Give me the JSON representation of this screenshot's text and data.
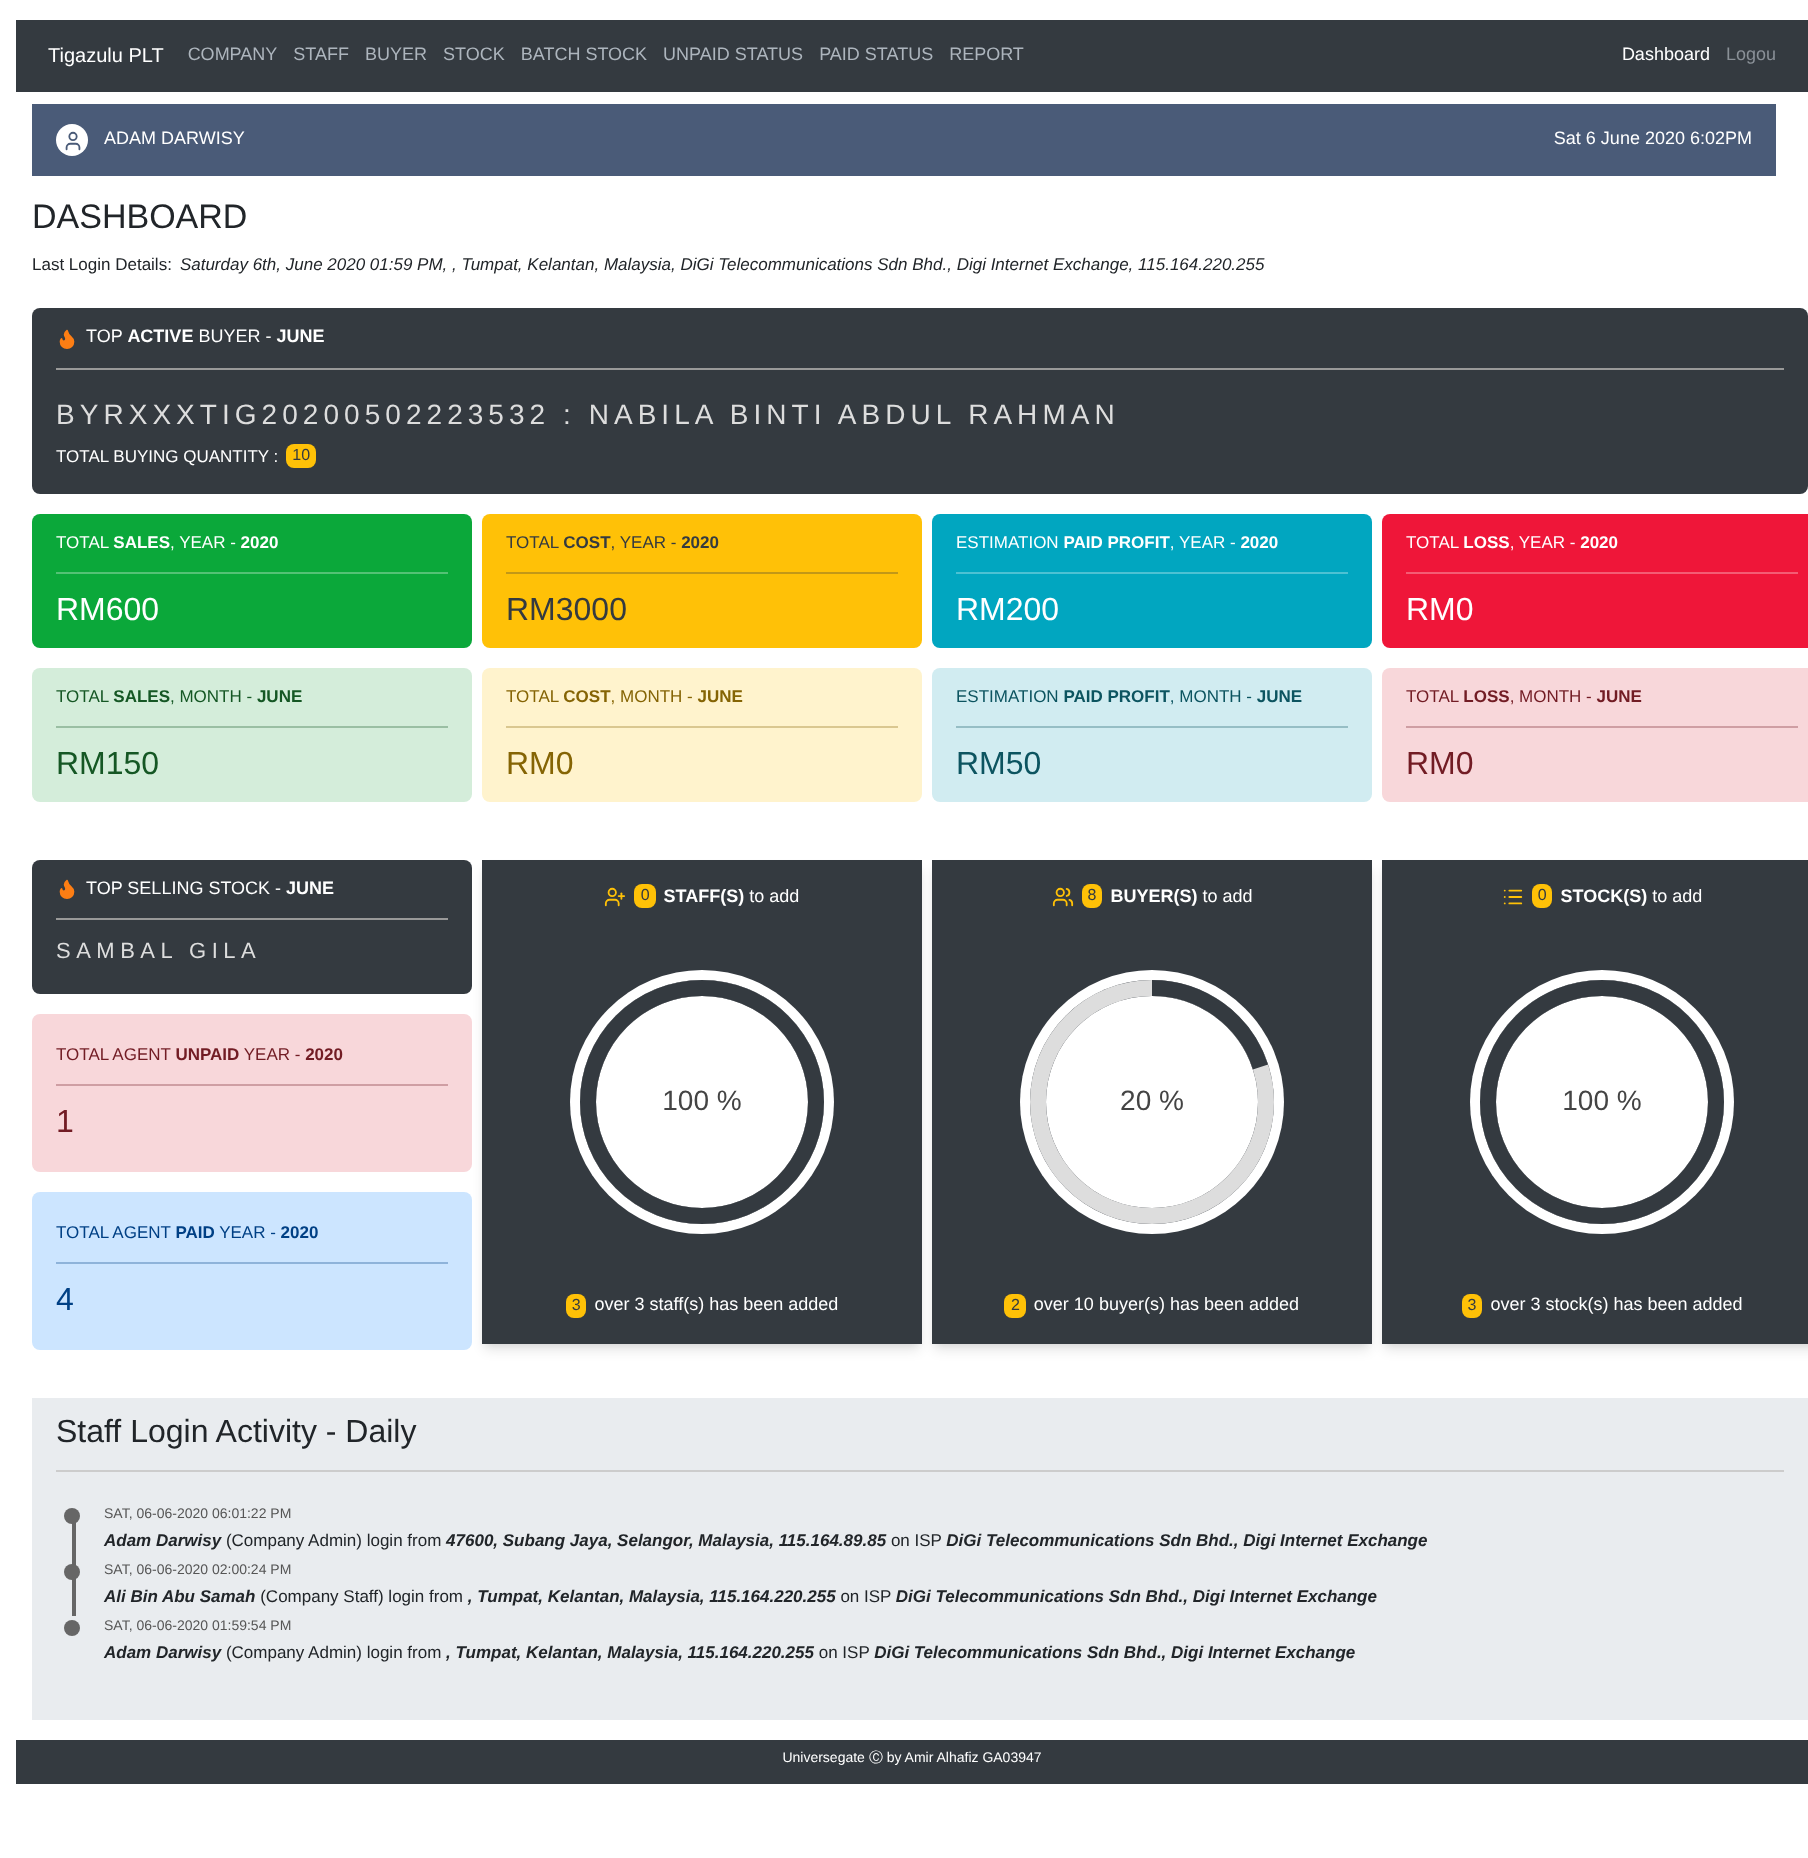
{
  "navbar": {
    "brand": "Tigazulu PLT",
    "items": [
      {
        "label": "COMPANY"
      },
      {
        "label": "STAFF"
      },
      {
        "label": "BUYER"
      },
      {
        "label": "STOCK"
      },
      {
        "label": "BATCH STOCK"
      },
      {
        "label": "UNPAID STATUS"
      },
      {
        "label": "PAID STATUS"
      },
      {
        "label": "REPORT"
      }
    ],
    "right": [
      {
        "label": "Dashboard",
        "selected": true
      },
      {
        "label": "Logou",
        "selected": false
      }
    ]
  },
  "user_bar": {
    "name": "ADAM DARWISY",
    "datetime": "Sat 6 June 2020 6:02PM"
  },
  "heading": "DASHBOARD",
  "last_login": {
    "label": "Last Login Details:",
    "value": "Saturday 6th, June 2020 01:59 PM, , Tumpat, Kelantan, Malaysia, DiGi Telecommunications Sdn Bhd., Digi Internet Exchange, 115.164.220.255"
  },
  "top_buyer": {
    "title": "TOP **ACTIVE** BUYER - **JUNE**",
    "name": "BYRXXXTIG20200502223532 : NABILA BINTI ABDUL RAHMAN",
    "quantity_label": "TOTAL BUYING QUANTITY :",
    "quantity": "10"
  },
  "stat_cards": [
    {
      "kind": "green",
      "title": "TOTAL **SALES**, YEAR - **2020**",
      "value": "RM600"
    },
    {
      "kind": "yellow",
      "title": "TOTAL **COST**, YEAR - **2020**",
      "value": "RM3000"
    },
    {
      "kind": "cyan",
      "title": "ESTIMATION **PAID PROFIT**, YEAR - **2020**",
      "value": "RM200"
    },
    {
      "kind": "red",
      "title": "TOTAL **LOSS**, YEAR - **2020**",
      "value": "RM0"
    },
    {
      "kind": "green-light",
      "title": "TOTAL **SALES**, MONTH - **JUNE**",
      "value": "RM150"
    },
    {
      "kind": "yellow-light",
      "title": "TOTAL **COST**, MONTH - **JUNE**",
      "value": "RM0"
    },
    {
      "kind": "cyan-light",
      "title": "ESTIMATION **PAID PROFIT**, MONTH - **JUNE**",
      "value": "RM50"
    },
    {
      "kind": "red-light",
      "title": "TOTAL **LOSS**, MONTH - **JUNE**",
      "value": "RM0"
    }
  ],
  "top_stock": {
    "title": "TOP SELLING STOCK - **JUNE**",
    "name": "SAMBAL GILA"
  },
  "agent_cards": [
    {
      "kind": "red-light",
      "title": "TOTAL AGENT **UNPAID** YEAR - **2020**",
      "value": "1"
    },
    {
      "kind": "blue-light",
      "title": "TOTAL AGENT **PAID** YEAR - **2020**",
      "value": "4"
    }
  ],
  "gauges": [
    {
      "kind": "staff",
      "badge": "0",
      "title": "**STAFF(S)** to add",
      "level": 1,
      "reading": "100 %",
      "footer_badge": "3",
      "footer": "over 3 staff(s) has been added"
    },
    {
      "kind": "buyer",
      "badge": "8",
      "title": "**BUYER(S)** to add",
      "level": 0.2,
      "reading": "20 %",
      "footer_badge": "2",
      "footer": "over 10 buyer(s) has been added"
    },
    {
      "kind": "stock",
      "badge": "0",
      "title": "**STOCK(S)** to add",
      "level": 1,
      "reading": "100 %",
      "footer_badge": "3",
      "footer": "over 3 stock(s) has been added"
    }
  ],
  "activity": {
    "title": "Staff Login Activity - Daily",
    "entries": [
      {
        "time": "SAT, 06-06-2020 06:01:22 PM",
        "text": "**Adam Darwisy** (Company Admin) login from **47600, Subang Jaya, Selangor, Malaysia, 115.164.89.85** on ISP **DiGi Telecommunications Sdn Bhd., Digi Internet Exchange**"
      },
      {
        "time": "SAT, 06-06-2020 02:00:24 PM",
        "text": "**Ali Bin Abu Samah** (Company Staff) login from **, Tumpat, Kelantan, Malaysia, 115.164.220.255** on ISP **DiGi Telecommunications Sdn Bhd., Digi Internet Exchange**"
      },
      {
        "time": "SAT, 06-06-2020 01:59:54 PM",
        "text": "**Adam Darwisy** (Company Admin) login from **, Tumpat, Kelantan, Malaysia, 115.164.220.255** on ISP **DiGi Telecommunications Sdn Bhd., Digi Internet Exchange**"
      }
    ]
  },
  "footer": "Universegate Ⓒ by Amir Alhafiz GA03947"
}
